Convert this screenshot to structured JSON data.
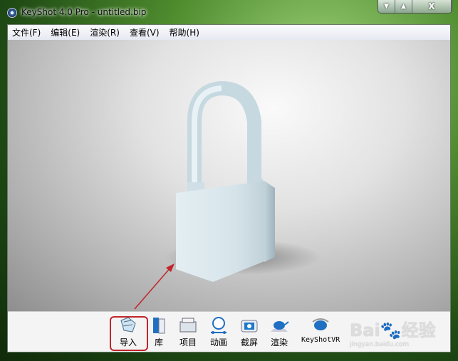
{
  "window": {
    "title": "KeyShot 4.0 Pro  - untitled.bip",
    "buttons": {
      "minimize": "▼",
      "maximize": "▲",
      "close": "X"
    }
  },
  "menu": {
    "items": [
      {
        "label": "文件(F)"
      },
      {
        "label": "编辑(E)"
      },
      {
        "label": "渲染(R)"
      },
      {
        "label": "查看(V)"
      },
      {
        "label": "帮助(H)"
      }
    ]
  },
  "viewport": {
    "model": "padlock"
  },
  "toolbar": {
    "items": [
      {
        "label": "导入",
        "icon": "import-icon",
        "highlighted": true
      },
      {
        "label": "库",
        "icon": "library-icon"
      },
      {
        "label": "项目",
        "icon": "project-icon"
      },
      {
        "label": "动画",
        "icon": "animation-icon"
      },
      {
        "label": "截屏",
        "icon": "screenshot-icon"
      },
      {
        "label": "渲染",
        "icon": "render-teapot-icon"
      },
      {
        "label": "KeyShotVR",
        "icon": "keyshotvr-teapot-icon"
      }
    ]
  },
  "annotation": {
    "color": "#c0262a"
  },
  "watermark": {
    "text": "Bai经验",
    "url": "jingyan.baidu.com"
  }
}
